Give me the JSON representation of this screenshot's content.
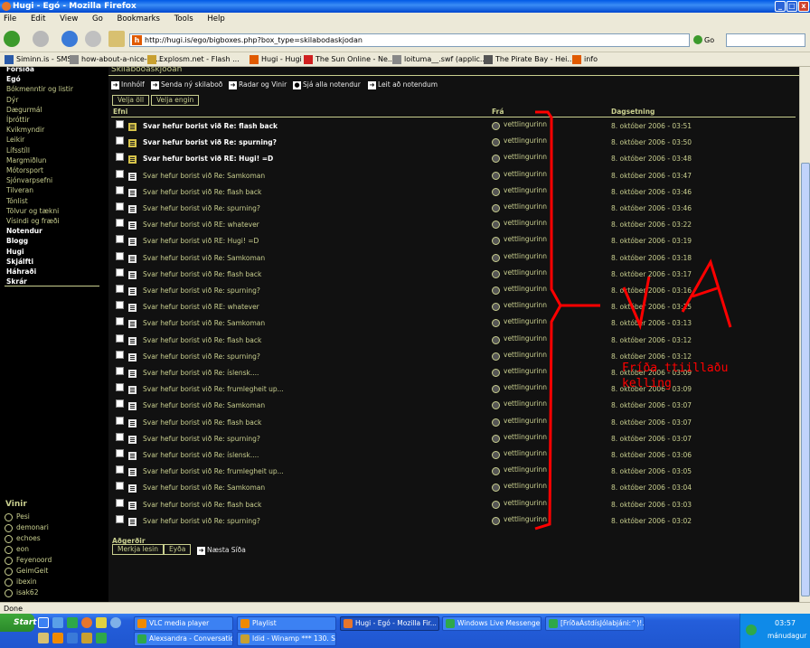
{
  "window": {
    "title": "Hugi - Egó - Mozilla Firefox"
  },
  "menu": [
    "File",
    "Edit",
    "View",
    "Go",
    "Bookmarks",
    "Tools",
    "Help"
  ],
  "nav": {
    "url": "http://hugi.is/ego/bigboxes.php?box_type=skilabodaskjodan",
    "go_label": "Go"
  },
  "bookmarks": [
    {
      "label": "Siminn.is - SMS",
      "icon": "siminn-icon",
      "color": "#2a5aa8"
    },
    {
      "label": "how-about-a-nice-cu...",
      "icon": "page-icon",
      "color": "#888888"
    },
    {
      "label": "Explosm.net - Flash ...",
      "icon": "explosm-icon",
      "color": "#c8a030"
    },
    {
      "label": "Hugi - Hugi",
      "icon": "hugi-icon",
      "color": "#e05a00"
    },
    {
      "label": "The Sun Online - Ne...",
      "icon": "sun-icon",
      "color": "#d02020"
    },
    {
      "label": "loituma__.swf (applic...",
      "icon": "page-icon",
      "color": "#888888"
    },
    {
      "label": "The Pirate Bay - Hei...",
      "icon": "piratebay-icon",
      "color": "#555555"
    },
    {
      "label": "info",
      "icon": "hugi-icon",
      "color": "#e05a00"
    }
  ],
  "sidebar": {
    "items": [
      {
        "label": "Forsíða",
        "style": "bold"
      },
      {
        "label": "Egó",
        "style": "sel"
      },
      {
        "label": "Bókmenntir og listir",
        "style": ""
      },
      {
        "label": "Dýr",
        "style": ""
      },
      {
        "label": "Dægurmál",
        "style": ""
      },
      {
        "label": "Íþróttir",
        "style": ""
      },
      {
        "label": "Kvikmyndir",
        "style": ""
      },
      {
        "label": "Leikir",
        "style": ""
      },
      {
        "label": "Lífsstíll",
        "style": ""
      },
      {
        "label": "Margmiðlun",
        "style": ""
      },
      {
        "label": "Mótorsport",
        "style": ""
      },
      {
        "label": "Sjónvarpsefni",
        "style": ""
      },
      {
        "label": "Tilveran",
        "style": ""
      },
      {
        "label": "Tónlist",
        "style": ""
      },
      {
        "label": "Tölvur og tækni",
        "style": ""
      },
      {
        "label": "Vísindi og fræði",
        "style": ""
      },
      {
        "label": "Notendur",
        "style": "bold"
      },
      {
        "label": "Blogg",
        "style": "bold"
      },
      {
        "label": "Hugi",
        "style": "bold"
      },
      {
        "label": "Skjálfti",
        "style": "bold"
      },
      {
        "label": "Háhraði",
        "style": "bold"
      },
      {
        "label": "Skrár",
        "style": "bold"
      }
    ],
    "friends_title": "Vinir",
    "friends": [
      "Pesi",
      "demonari",
      "echoes",
      "eon",
      "Feyenoord",
      "GeimGeit",
      "ibexin",
      "isak62"
    ]
  },
  "main": {
    "box_title": "Skilaboðaskjóðan",
    "toolbar": [
      "Innhólf",
      "Senda ný skilaboð",
      "Radar og Vinir",
      "Sjá alla notendur",
      "Leit að notendum"
    ],
    "select_all": "Velja öll",
    "select_none": "Velja engin",
    "col_subject": "Efni",
    "col_from": "Frá",
    "col_date": "Dagsetning",
    "actions_title": "Aðgerðir",
    "mark_read": "Merkja lesin",
    "delete": "Eyða",
    "next_page": "Næsta Síða"
  },
  "messages": [
    {
      "subject": "Svar hefur borist við Re: flash back",
      "from": "vettlingurinn",
      "date": "8. október 2006 - 03:51",
      "unread": true
    },
    {
      "subject": "Svar hefur borist við Re: spurning?",
      "from": "vettlingurinn",
      "date": "8. október 2006 - 03:50",
      "unread": true
    },
    {
      "subject": "Svar hefur borist við RE: Hugi! =D",
      "from": "vettlingurinn",
      "date": "8. október 2006 - 03:48",
      "unread": true
    },
    {
      "subject": "Svar hefur borist við Re: Samkoman",
      "from": "vettlingurinn",
      "date": "8. október 2006 - 03:47",
      "unread": false
    },
    {
      "subject": "Svar hefur borist við Re: flash back",
      "from": "vettlingurinn",
      "date": "8. október 2006 - 03:46",
      "unread": false
    },
    {
      "subject": "Svar hefur borist við Re: spurning?",
      "from": "vettlingurinn",
      "date": "8. október 2006 - 03:46",
      "unread": false
    },
    {
      "subject": "Svar hefur borist við RE: whatever",
      "from": "vettlingurinn",
      "date": "8. október 2006 - 03:22",
      "unread": false
    },
    {
      "subject": "Svar hefur borist við RE: Hugi! =D",
      "from": "vettlingurinn",
      "date": "8. október 2006 - 03:19",
      "unread": false
    },
    {
      "subject": "Svar hefur borist við Re: Samkoman",
      "from": "vettlingurinn",
      "date": "8. október 2006 - 03:18",
      "unread": false
    },
    {
      "subject": "Svar hefur borist við Re: flash back",
      "from": "vettlingurinn",
      "date": "8. október 2006 - 03:17",
      "unread": false
    },
    {
      "subject": "Svar hefur borist við Re: spurning?",
      "from": "vettlingurinn",
      "date": "8. október 2006 - 03:16",
      "unread": false
    },
    {
      "subject": "Svar hefur borist við RE: whatever",
      "from": "vettlingurinn",
      "date": "8. október 2006 - 03:15",
      "unread": false
    },
    {
      "subject": "Svar hefur borist við Re: Samkoman",
      "from": "vettlingurinn",
      "date": "8. október 2006 - 03:13",
      "unread": false
    },
    {
      "subject": "Svar hefur borist við Re: flash back",
      "from": "vettlingurinn",
      "date": "8. október 2006 - 03:12",
      "unread": false
    },
    {
      "subject": "Svar hefur borist við Re: spurning?",
      "from": "vettlingurinn",
      "date": "8. október 2006 - 03:12",
      "unread": false
    },
    {
      "subject": "Svar hefur borist við Re: íslensk....",
      "from": "vettlingurinn",
      "date": "8. október 2006 - 03:09",
      "unread": false
    },
    {
      "subject": "Svar hefur borist við Re: frumlegheit up...",
      "from": "vettlingurinn",
      "date": "8. október 2006 - 03:09",
      "unread": false
    },
    {
      "subject": "Svar hefur borist við Re: Samkoman",
      "from": "vettlingurinn",
      "date": "8. október 2006 - 03:07",
      "unread": false
    },
    {
      "subject": "Svar hefur borist við Re: flash back",
      "from": "vettlingurinn",
      "date": "8. október 2006 - 03:07",
      "unread": false
    },
    {
      "subject": "Svar hefur borist við Re: spurning?",
      "from": "vettlingurinn",
      "date": "8. október 2006 - 03:07",
      "unread": false
    },
    {
      "subject": "Svar hefur borist við Re: íslensk....",
      "from": "vettlingurinn",
      "date": "8. október 2006 - 03:06",
      "unread": false
    },
    {
      "subject": "Svar hefur borist við Re: frumlegheit up...",
      "from": "vettlingurinn",
      "date": "8. október 2006 - 03:05",
      "unread": false
    },
    {
      "subject": "Svar hefur borist við Re: Samkoman",
      "from": "vettlingurinn",
      "date": "8. október 2006 - 03:04",
      "unread": false
    },
    {
      "subject": "Svar hefur borist við Re: flash back",
      "from": "vettlingurinn",
      "date": "8. október 2006 - 03:03",
      "unread": false
    },
    {
      "subject": "Svar hefur borist við Re: spurning?",
      "from": "vettlingurinn",
      "date": "8. október 2006 - 03:02",
      "unread": false
    }
  ],
  "annotation": {
    "big_text": "VA",
    "note_line1": "Fríða ttiillaðu",
    "note_line2": "kelling",
    "color": "#ff0000"
  },
  "status": {
    "text": "Done"
  },
  "taskbar": {
    "start": "Start",
    "tasks_row1": [
      {
        "label": "VLC media player",
        "icon": "vlc-icon",
        "color": "#f08a00",
        "active": false
      },
      {
        "label": "Playlist",
        "icon": "vlc-icon",
        "color": "#f08a00",
        "active": false
      },
      {
        "label": "Hugi - Egó - Mozilla Fir...",
        "icon": "firefox-icon",
        "color": "#e8762b",
        "active": true
      },
      {
        "label": "Windows Live Messenger",
        "icon": "messenger-icon",
        "color": "#2ea84a",
        "active": false
      },
      {
        "label": "[FríðaÁstdísJólabjáni:^)!...",
        "icon": "chat-icon",
        "color": "#2ea84a",
        "active": false
      }
    ],
    "tasks_row2": [
      {
        "label": "Alexsandra - Conversation",
        "icon": "chat-icon",
        "color": "#2ea84a",
        "active": false
      },
      {
        "label": "Idid - Winamp *** 130. S...",
        "icon": "winamp-icon",
        "color": "#c8a030",
        "active": false
      }
    ],
    "clock": "03:57",
    "day": "mánudagur"
  }
}
